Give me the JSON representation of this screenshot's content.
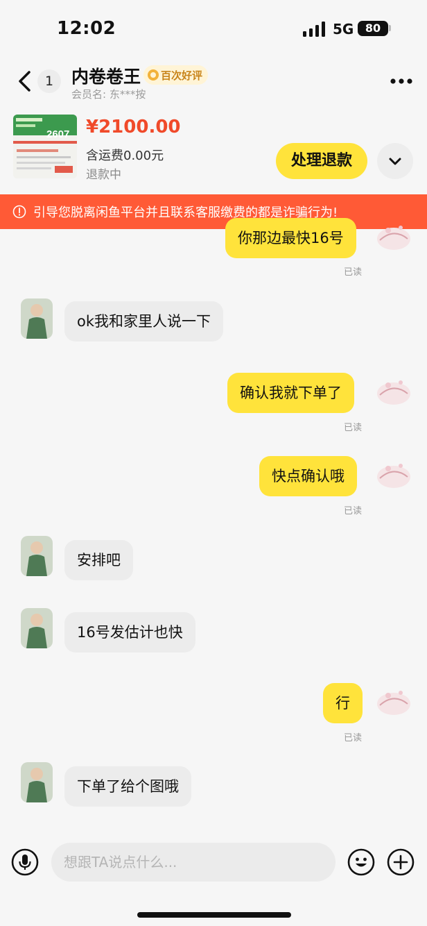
{
  "status_bar": {
    "time": "12:02",
    "network": "5G",
    "battery": "80"
  },
  "header": {
    "unread_count": "1",
    "contact_name": "内卷卷王",
    "rating_badge": "百次好评",
    "member_label": "会员名: 东***按"
  },
  "product": {
    "thumb_text": "2607",
    "price": "¥2100.00",
    "shipping": "含运费0.00元",
    "status": "退款中",
    "action_label": "处理退款"
  },
  "warning": "引导您脱离闲鱼平台并且联系客服缴费的都是诈骗行为!",
  "messages": [
    {
      "side": "mine",
      "text": "你那边最快16号",
      "status": "已读"
    },
    {
      "side": "theirs",
      "text": "ok我和家里人说一下"
    },
    {
      "side": "mine",
      "text": "确认我就下单了",
      "status": "已读"
    },
    {
      "side": "mine",
      "text": "快点确认哦",
      "status": "已读"
    },
    {
      "side": "theirs",
      "text": "安排吧"
    },
    {
      "side": "theirs",
      "text": "16号发估计也快"
    },
    {
      "side": "mine",
      "text": "行",
      "status": "已读"
    },
    {
      "side": "theirs",
      "text": "下单了给个图哦"
    }
  ],
  "input": {
    "placeholder": "想跟TA说点什么..."
  },
  "colors": {
    "accent": "#ffe33b",
    "price": "#f04a2a",
    "warning": "#ff5a36",
    "bubble_other": "#ececec"
  }
}
